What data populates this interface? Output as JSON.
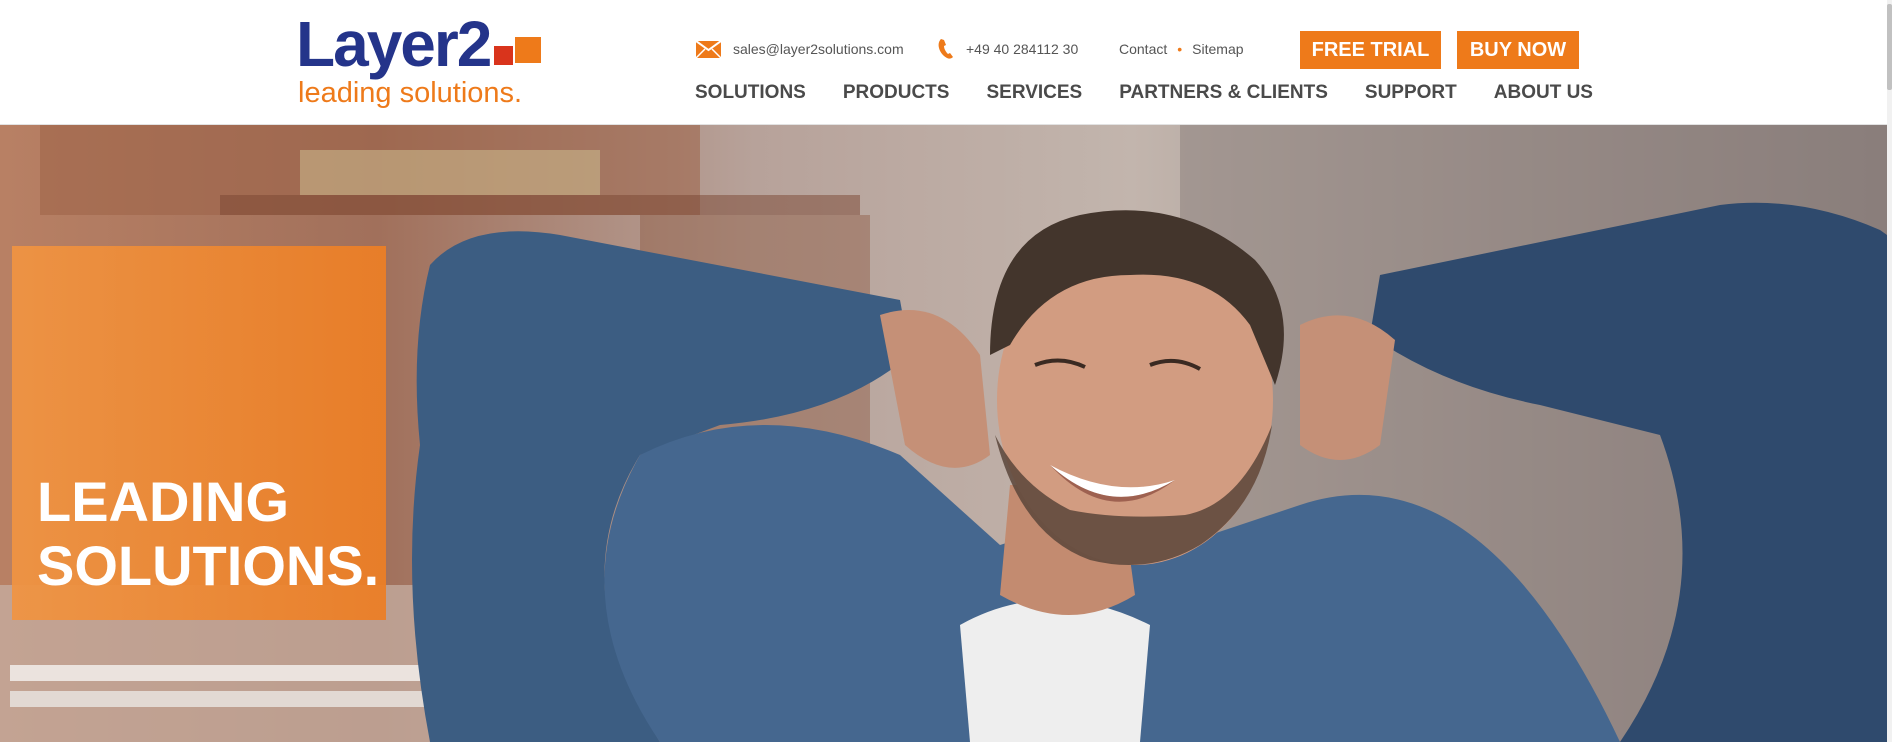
{
  "brand": {
    "name": "Layer2",
    "tagline": "leading solutions.",
    "colors": {
      "navy": "#24348a",
      "orange": "#ee7a1a",
      "red": "#d9341c"
    }
  },
  "contact": {
    "email": "sales@layer2solutions.com",
    "email_icon": "envelope-icon",
    "phone": "+49 40 284112 30",
    "phone_icon": "phone-icon",
    "links": [
      "Contact",
      "Sitemap"
    ]
  },
  "cta": {
    "trial": "FREE TRIAL",
    "buy": "BUY NOW"
  },
  "nav": [
    "SOLUTIONS",
    "PRODUCTS",
    "SERVICES",
    "PARTNERS & CLIENTS",
    "SUPPORT",
    "ABOUT US"
  ],
  "hero": {
    "title": "LEADING\nSOLUTIONS.",
    "image": "smiling-man-relaxing-photo"
  }
}
